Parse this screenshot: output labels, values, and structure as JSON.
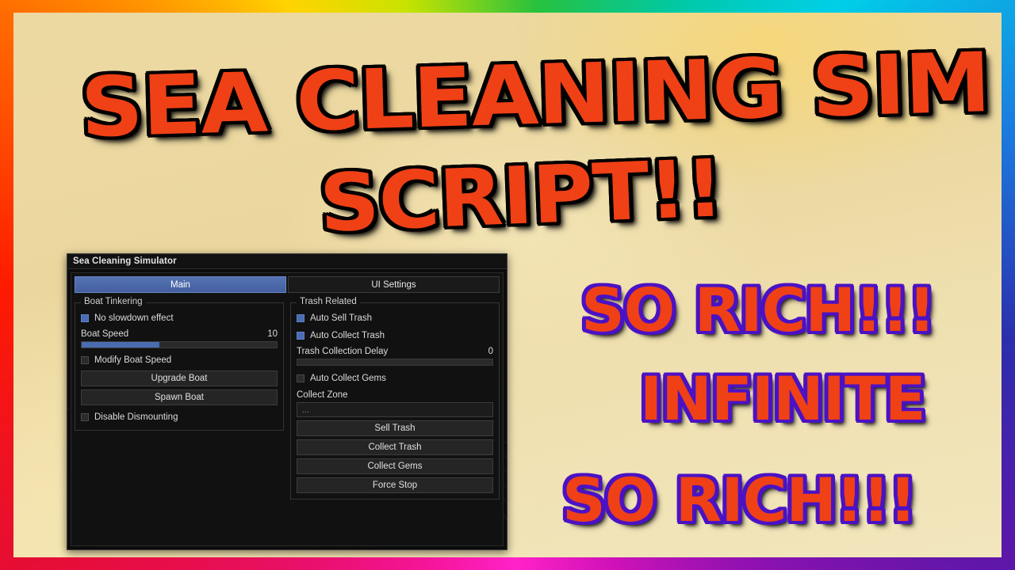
{
  "thumbnail": {
    "title_line1": "SEA CLEANING SIM",
    "title_line2": "SCRIPT!!",
    "hype_line1": "SO RICH!!!",
    "hype_line2": "INFINITE",
    "hype_line3": "SO RICH!!!",
    "colors": {
      "background": "#ecd9a2",
      "text_fill": "#f04016",
      "title_outline": "#000000",
      "hype_outline": "#4b12c4"
    }
  },
  "gui": {
    "window_title": "Sea Cleaning Simulator",
    "tabs": [
      {
        "label": "Main",
        "active": true
      },
      {
        "label": "UI Settings",
        "active": false
      }
    ],
    "left_column": {
      "group_title": "Boat Tinkering",
      "no_slowdown": {
        "label": "No slowdown effect",
        "checked": true
      },
      "boat_speed": {
        "label": "Boat Speed",
        "value": "10",
        "fill_percent": 40
      },
      "modify_boat_speed": {
        "label": "Modify Boat Speed",
        "checked": false
      },
      "upgrade_boat_button": "Upgrade Boat",
      "spawn_boat_button": "Spawn Boat",
      "disable_dismounting": {
        "label": "Disable Dismounting",
        "checked": false
      }
    },
    "right_column": {
      "group_title": "Trash Related",
      "auto_sell_trash": {
        "label": "Auto Sell Trash",
        "checked": true
      },
      "auto_collect_trash": {
        "label": "Auto Collect Trash",
        "checked": true
      },
      "trash_collection_delay": {
        "label": "Trash Collection Delay",
        "value": "0",
        "fill_percent": 0
      },
      "auto_collect_gems": {
        "label": "Auto Collect Gems",
        "checked": false
      },
      "collect_zone": {
        "label": "Collect Zone",
        "value": "...",
        "placeholder": "..."
      },
      "sell_trash_button": "Sell Trash",
      "collect_trash_button": "Collect Trash",
      "collect_gems_button": "Collect Gems",
      "force_stop_button": "Force Stop"
    },
    "colors": {
      "panel_bg": "#0c0c0c",
      "accent_blue": "#4a6cb0",
      "tab_active": "#4d6aa9",
      "button_bg": "#252525",
      "text": "#dcdcdc"
    }
  }
}
